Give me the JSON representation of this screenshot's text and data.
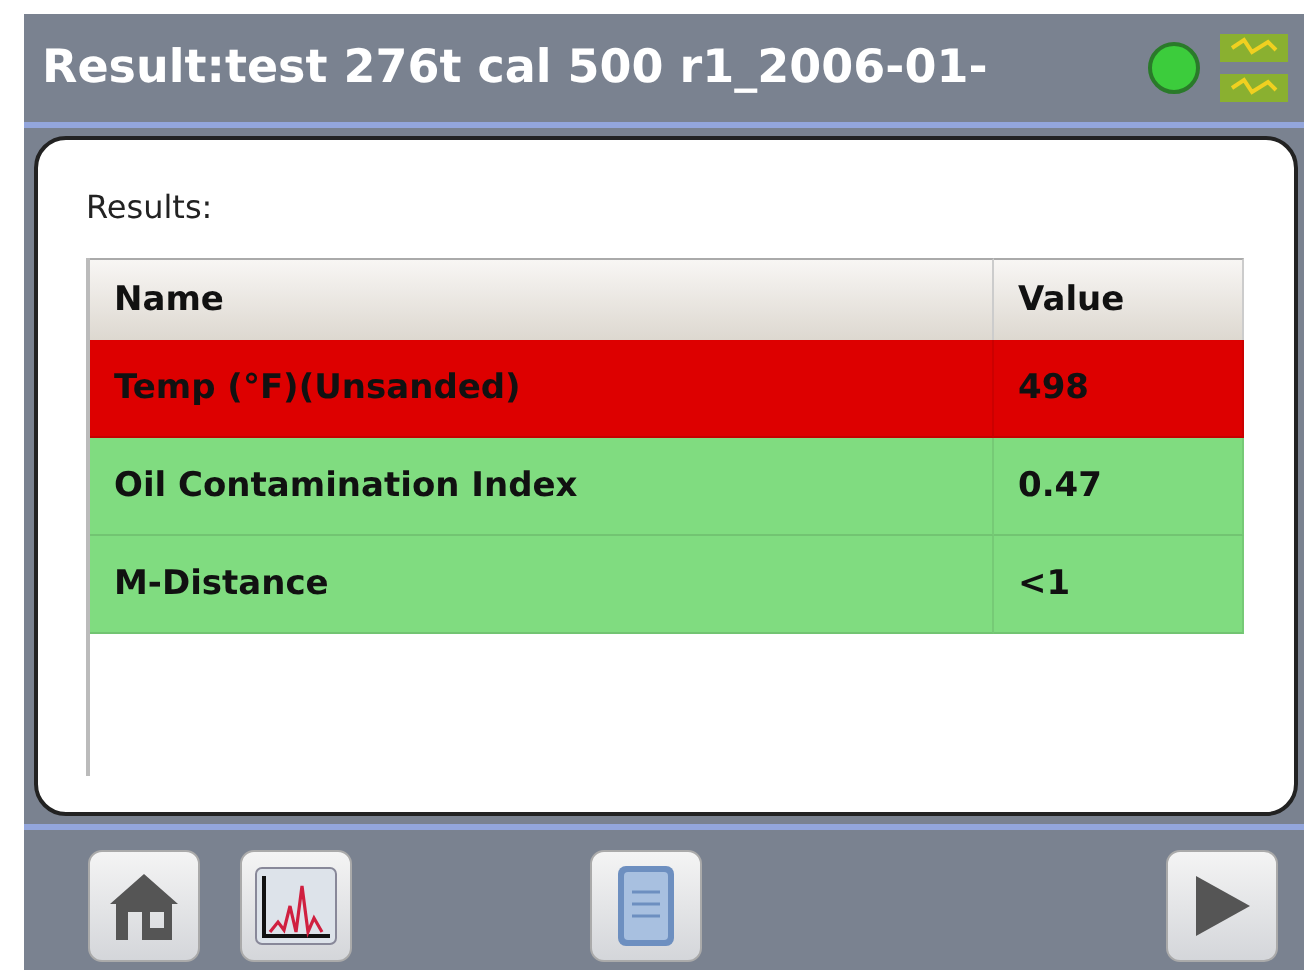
{
  "header": {
    "title": "Result:test 276t cal 500 r1_2006-01-",
    "connected": true
  },
  "panel": {
    "label": "Results:"
  },
  "table": {
    "columns": [
      "Name",
      "Value"
    ],
    "rows": [
      {
        "name": "Temp (°F)(Unsanded)",
        "value": "498",
        "color": "#dd0000"
      },
      {
        "name": "Oil Contamination Index",
        "value": "0.47",
        "color": "#80dc80"
      },
      {
        "name": "M-Distance",
        "value": "<1",
        "color": "#80dc80"
      }
    ]
  },
  "toolbar": [
    {
      "kind": "home"
    },
    {
      "kind": "chart"
    },
    {
      "kind": "report"
    },
    {
      "kind": "next"
    }
  ]
}
